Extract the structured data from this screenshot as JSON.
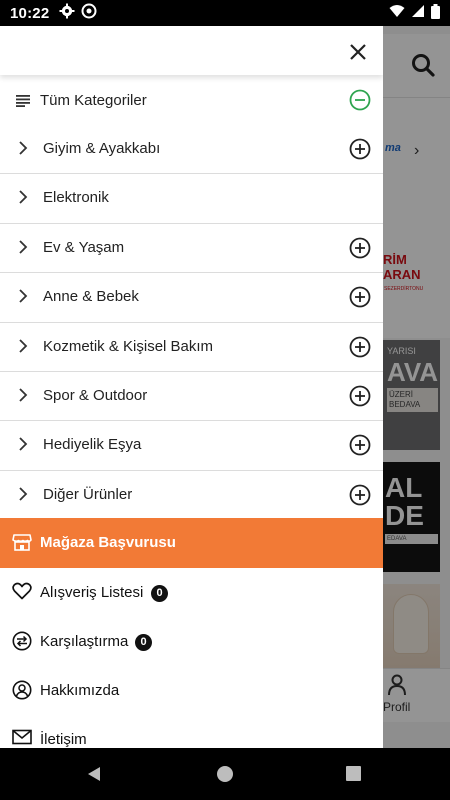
{
  "status_bar": {
    "time": "10:22"
  },
  "background": {
    "brand_partial": "ma",
    "promo_red": [
      "RİM",
      "ARAN"
    ],
    "promo_red_sub": "SEZERDİRTONU",
    "card1_lines": [
      "YARISI",
      "AVA"
    ],
    "card1_tags": [
      "ÜZERİ",
      "BEDAVA"
    ],
    "card2_lines": [
      "AL",
      "DE"
    ],
    "card2_tag": "EDAVA",
    "bottom_nav_profile": "Profil"
  },
  "drawer": {
    "all_categories_label": "Tüm Kategoriler",
    "categories": [
      {
        "label": "Giyim & Ayakkabı",
        "expandable": true
      },
      {
        "label": "Elektronik",
        "expandable": false
      },
      {
        "label": "Ev & Yaşam",
        "expandable": true
      },
      {
        "label": "Anne & Bebek",
        "expandable": true
      },
      {
        "label": "Kozmetik & Kişisel Bakım",
        "expandable": true
      },
      {
        "label": "Spor & Outdoor",
        "expandable": true
      },
      {
        "label": "Hediyelik Eşya",
        "expandable": true
      },
      {
        "label": "Diğer Ürünler",
        "expandable": true
      }
    ],
    "store_application_label": "Mağaza Başvurusu",
    "shopping_list": {
      "label": "Alışveriş Listesi",
      "count": "0"
    },
    "compare": {
      "label": "Karşılaştırma",
      "count": "0"
    },
    "about_label": "Hakkımızda",
    "contact_label": "İletişim"
  },
  "colors": {
    "accent_orange": "#f27a36",
    "minus_green": "#2ea44f",
    "badge_black": "#111111"
  },
  "icons": {
    "close": "close-icon",
    "hamburger": "menu-list-icon",
    "minus": "minus-circle-icon",
    "plus": "plus-circle-icon",
    "chevron": "chevron-right-icon",
    "store": "store-icon",
    "heart": "heart-icon",
    "compare": "compare-arrows-icon",
    "about": "person-badge-icon",
    "mail": "mail-icon"
  }
}
